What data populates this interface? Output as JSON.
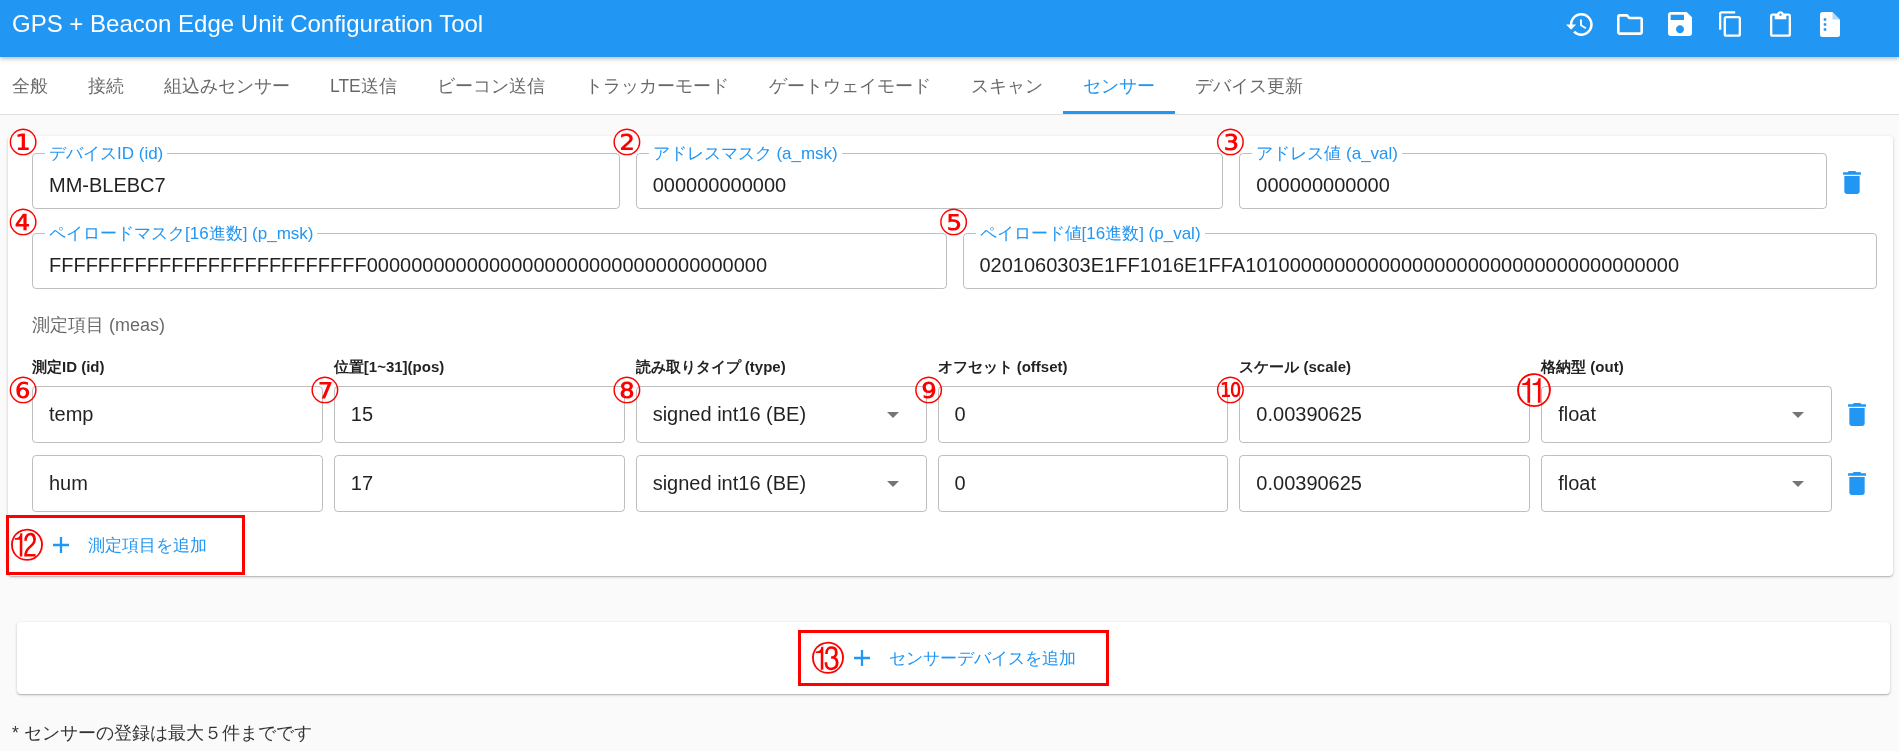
{
  "app_bar": {
    "title": "GPS + Beacon Edge Unit Configuration Tool"
  },
  "tabs": [
    {
      "label": "全般",
      "selected": false
    },
    {
      "label": "接続",
      "selected": false
    },
    {
      "label": "組込みセンサー",
      "selected": false
    },
    {
      "label": "LTE送信",
      "selected": false
    },
    {
      "label": "ビーコン送信",
      "selected": false
    },
    {
      "label": "トラッカーモード",
      "selected": false
    },
    {
      "label": "ゲートウェイモード",
      "selected": false
    },
    {
      "label": "スキャン",
      "selected": false
    },
    {
      "label": "センサー",
      "selected": true
    },
    {
      "label": "デバイス更新",
      "selected": false
    }
  ],
  "sensor_device": {
    "address_fields": [
      {
        "label": "デバイスID (id)",
        "value": "MM-BLEBC7",
        "callout": "①"
      },
      {
        "label": "アドレスマスク (a_msk)",
        "value": "000000000000",
        "callout": "②"
      },
      {
        "label": "アドレス値 (a_val)",
        "value": "000000000000",
        "callout": "③"
      }
    ],
    "payload_fields": [
      {
        "label": "ペイロードマスク[16進数] (p_msk)",
        "value": "FFFFFFFFFFFFFFFFFFFFFFFFFF000000000000000000000000000000000000",
        "callout": "④"
      },
      {
        "label": "ペイロード値[16進数] (p_val)",
        "value": "0201060303E1FF1016E1FFA101000000000000000000000000000000000000",
        "callout": "⑤"
      }
    ],
    "meas": {
      "title": "測定項目 (meas)",
      "columns": [
        {
          "label": "測定ID (id)",
          "kind": "text",
          "callout": "⑥"
        },
        {
          "label": "位置[1~31](pos)",
          "kind": "text",
          "callout": "⑦"
        },
        {
          "label": "読み取りタイプ (type)",
          "kind": "select",
          "callout": "⑧"
        },
        {
          "label": "オフセット (offset)",
          "kind": "text",
          "callout": "⑨"
        },
        {
          "label": "スケール (scale)",
          "kind": "text",
          "callout": "⑩"
        },
        {
          "label": "格納型 (out)",
          "kind": "select",
          "callout": "⑪"
        }
      ],
      "rows": [
        {
          "cells": [
            "temp",
            "15",
            "signed int16 (BE)",
            "0",
            "0.00390625",
            "float"
          ]
        },
        {
          "cells": [
            "hum",
            "17",
            "signed int16 (BE)",
            "0",
            "0.00390625",
            "float"
          ]
        }
      ]
    },
    "add_measurement": {
      "label": "測定項目を追加",
      "callout": "⑫",
      "highlighted": true
    }
  },
  "add_device": {
    "label": "センサーデバイスを追加",
    "callout": "⑬",
    "highlighted": true
  },
  "footnote": "* センサーの登録は最大５件までです"
}
